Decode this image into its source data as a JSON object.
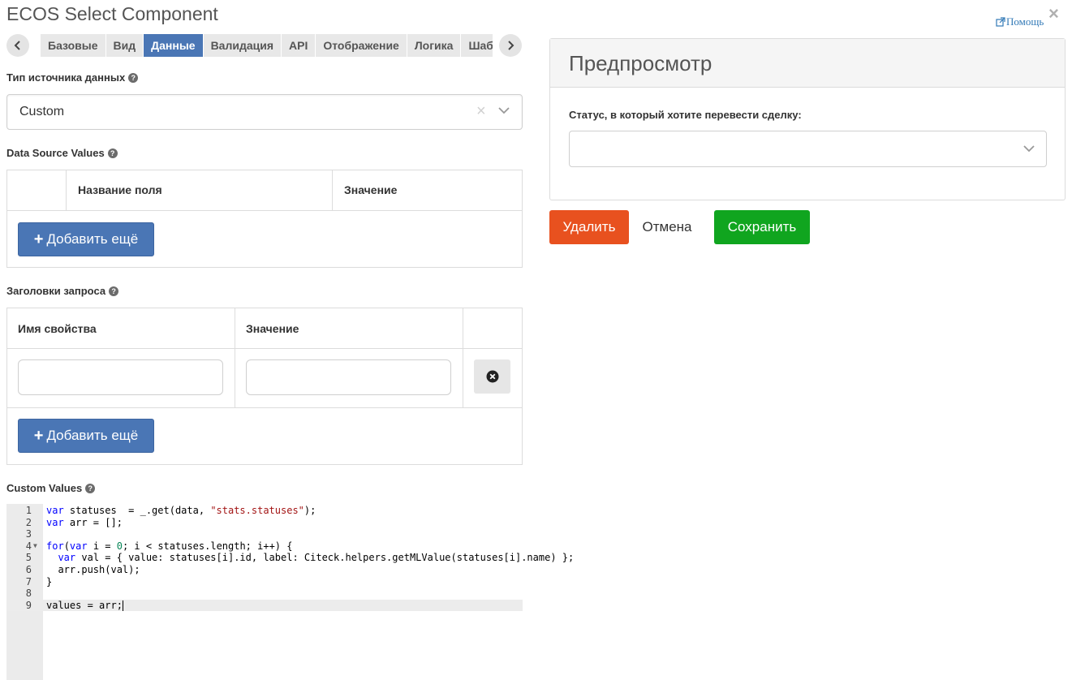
{
  "window": {
    "title": "ECOS Select Component",
    "help_label": "Помощь"
  },
  "tabs": [
    {
      "label": "Базовые"
    },
    {
      "label": "Вид"
    },
    {
      "label": "Данные",
      "active": true
    },
    {
      "label": "Валидация"
    },
    {
      "label": "API"
    },
    {
      "label": "Отображение"
    },
    {
      "label": "Логика"
    },
    {
      "label": "Шаблон"
    }
  ],
  "datasource": {
    "label": "Тип источника данных",
    "value": "Custom"
  },
  "values_table": {
    "label": "Data Source Values",
    "headers": [
      "Название поля",
      "Значение"
    ],
    "add_label": "Добавить ещё"
  },
  "headers_table": {
    "label": "Заголовки запроса",
    "headers": [
      "Имя свойства",
      "Значение"
    ],
    "add_label": "Добавить ещё"
  },
  "custom_values": {
    "label": "Custom Values",
    "code_lines": [
      "var statuses  = _.get(data, \"stats.statuses\");",
      "var arr = [];",
      "",
      "for(var i = 0; i < statuses.length; i++) {",
      "  var val = { value: statuses[i].id, label: Citeck.helpers.getMLValue(statuses[i].name) };",
      "  arr.push(val);",
      "}",
      "",
      "values = arr;"
    ],
    "current_line": 9
  },
  "preview": {
    "title": "Предпросмотр",
    "field_label": "Статус, в который хотите перевести сделку:",
    "field_value": ""
  },
  "actions": {
    "delete": "Удалить",
    "cancel": "Отмена",
    "save": "Сохранить"
  },
  "colors": {
    "primary": "#4a76b5",
    "danger": "#e8511f",
    "success": "#10a51f"
  }
}
